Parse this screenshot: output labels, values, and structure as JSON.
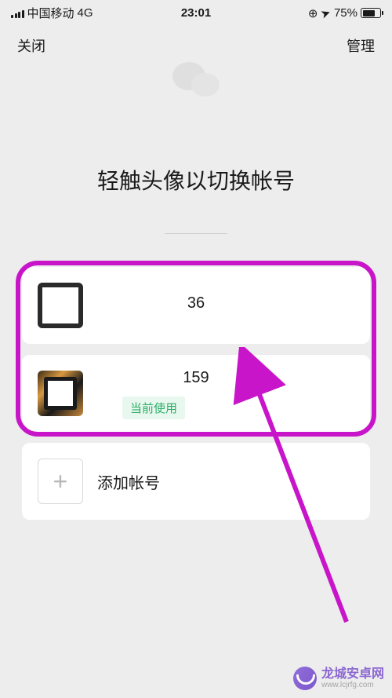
{
  "status": {
    "carrier": "中国移动",
    "network": "4G",
    "time": "23:01",
    "rotation_lock": "⊕",
    "location": "➤",
    "battery_pct": "75%",
    "battery_level": 75
  },
  "nav": {
    "close": "关闭",
    "manage": "管理"
  },
  "page": {
    "title": "轻触头像以切换帐号"
  },
  "accounts": [
    {
      "display_fragment": "36",
      "current": false
    },
    {
      "display_fragment": "159",
      "current": true
    }
  ],
  "labels": {
    "current_badge": "当前使用",
    "add_account": "添加帐号"
  },
  "annotation": {
    "highlight_color": "#c815c9"
  },
  "watermark": {
    "name_cn": "龙城安卓网",
    "name_en": "www.lcjrfg.com"
  }
}
